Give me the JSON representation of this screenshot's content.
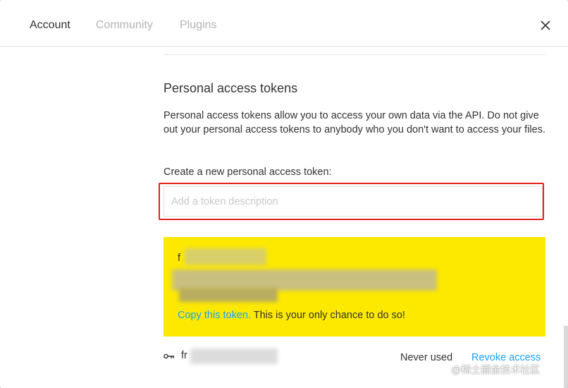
{
  "tabs": [
    {
      "label": "Account",
      "active": true
    },
    {
      "label": "Community",
      "active": false
    },
    {
      "label": "Plugins",
      "active": false
    }
  ],
  "close_icon": "close-icon",
  "section": {
    "title": "Personal access tokens",
    "description": "Personal access tokens allow you to access your own data via the API. Do not give out your personal access tokens to anybody who you don't want to access your files.",
    "create_label": "Create a new personal access token:",
    "input_placeholder": "Add a token description",
    "input_value": ""
  },
  "new_token": {
    "name_visible": "f",
    "copy_link": "Copy this token.",
    "copy_note": " This is your only chance to do so!",
    "background": "#fde900"
  },
  "existing_token": {
    "icon": "key-icon",
    "name_visible": "fr",
    "usage": "Never used",
    "revoke_label": "Revoke access"
  },
  "colors": {
    "link": "#18a0fb",
    "highlight_border": "#e3201b",
    "text": "#333333",
    "tab_inactive": "#b3b3b3"
  },
  "watermark": "@稀土掘金技术社区"
}
